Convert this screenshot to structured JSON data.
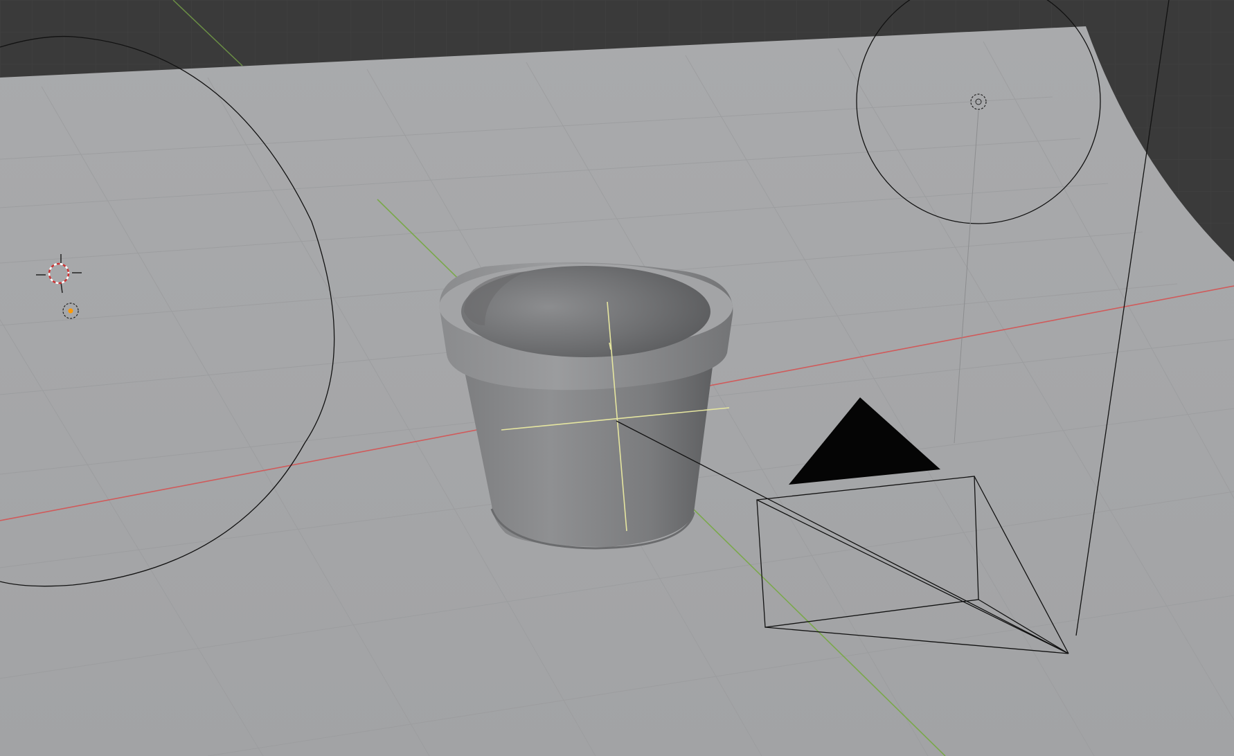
{
  "viewport": {
    "background_color": "#3a3a3a",
    "backdrop_color": "#a5a6a8",
    "grid_color": "#9a9b9d",
    "x_axis_color": "#d05555",
    "y_axis_color": "#7aa84a",
    "gizmo_color": "#e6e6a0",
    "wire_color": "#111111",
    "cursor_ring_colors": [
      "#cc3333",
      "#ffffff"
    ],
    "origin_dot_color": "#ff9900"
  },
  "objects": [
    {
      "kind": "backdrop-plane",
      "icon": "plane-mesh"
    },
    {
      "kind": "flower-pot",
      "icon": "mesh",
      "color": "#8e8f91"
    },
    {
      "kind": "area-light",
      "icon": "light-area"
    },
    {
      "kind": "spot-light",
      "icon": "light-spot"
    },
    {
      "kind": "camera",
      "icon": "camera"
    },
    {
      "kind": "3d-cursor",
      "icon": "cursor"
    },
    {
      "kind": "point-light",
      "icon": "light-point"
    }
  ]
}
